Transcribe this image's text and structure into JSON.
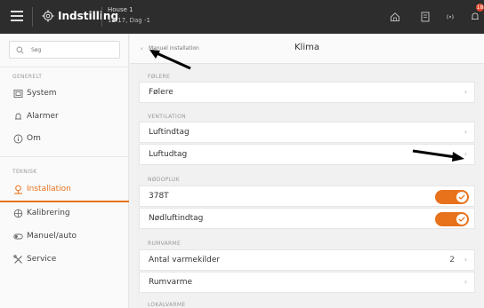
{
  "topbar": {
    "title": "Indstilling",
    "house": "House 1",
    "time": "13:17, Dag -1",
    "badge_count": "18"
  },
  "sidebar": {
    "search_placeholder": "Søg",
    "groups": [
      {
        "label": "GENERELT"
      },
      {
        "label": "TEKNISK"
      }
    ],
    "items": [
      {
        "label": "System"
      },
      {
        "label": "Alarmer"
      },
      {
        "label": "Om"
      },
      {
        "label": "Installation"
      },
      {
        "label": "Kalibrering"
      },
      {
        "label": "Manuel/auto"
      },
      {
        "label": "Service"
      }
    ],
    "accent_color": "#e8721c"
  },
  "main": {
    "back_label": "Manuel installation",
    "title": "Klima",
    "sections": [
      {
        "label": "FØLERE",
        "rows": [
          {
            "label": "Følere"
          }
        ]
      },
      {
        "label": "VENTILATION",
        "rows": [
          {
            "label": "Luftindtag"
          },
          {
            "label": "Luftudtag"
          }
        ]
      },
      {
        "label": "NØDOPLUK",
        "rows": [
          {
            "label": "378T",
            "toggle": true
          },
          {
            "label": "Nødluftindtag",
            "toggle": true
          }
        ]
      },
      {
        "label": "RUMVARME",
        "rows": [
          {
            "label": "Antal varmekilder",
            "value": "2"
          },
          {
            "label": "Rumvarme"
          }
        ]
      },
      {
        "label": "LOKALVARME"
      }
    ]
  }
}
